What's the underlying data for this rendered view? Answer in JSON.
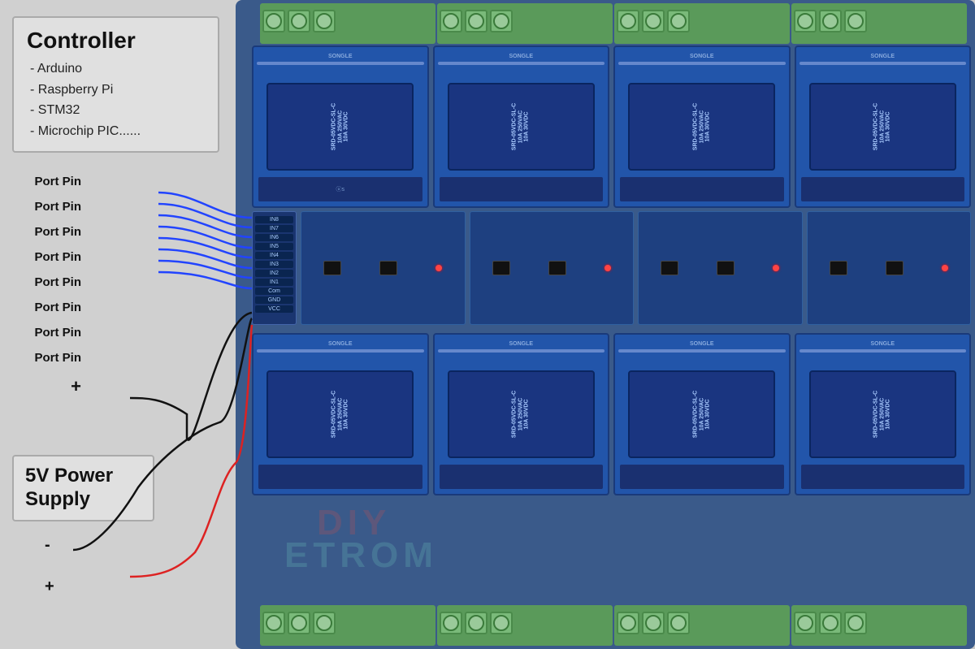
{
  "controller": {
    "title": "Controller",
    "items": [
      "- Arduino",
      "- Raspberry Pi",
      "- STM32",
      "- Microchip PIC......"
    ]
  },
  "port_pins": [
    "Port Pin",
    "Port Pin",
    "Port Pin",
    "Port Pin",
    "Port Pin",
    "Port Pin",
    "Port Pin",
    "Port Pin"
  ],
  "power_supply": {
    "title": "5V Power\nSupply",
    "terminals": [
      {
        "label": "-"
      },
      {
        "label": "+"
      }
    ]
  },
  "controller_terminals": {
    "label": "+"
  },
  "relay": {
    "label1": "SRD-05VDC-SL-C",
    "label2": "10A 250VAC",
    "label3": "10A 30VDC",
    "brand": "SONGLE",
    "certification": "us"
  },
  "input_pins": [
    "IN8",
    "IN7",
    "IN6",
    "IN5",
    "IN4",
    "IN3",
    "IN2",
    "IN1",
    "Com",
    "GND",
    "VCC"
  ],
  "colors": {
    "board_bg": "#3a5a8a",
    "relay_blue": "#2255aa",
    "terminal_green": "#5a9a5a",
    "wire_blue": "#2244ff",
    "wire_black": "#111111",
    "wire_red": "#dd2222"
  }
}
